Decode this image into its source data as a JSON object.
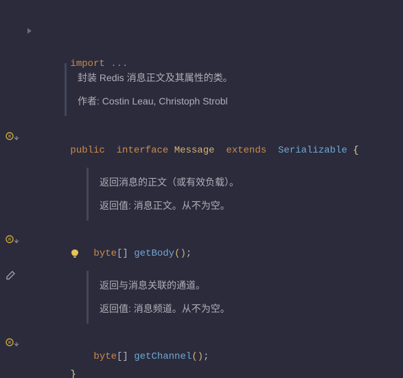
{
  "fold": {
    "import_kw": "import",
    "ellipsis": " ..."
  },
  "doc_class": {
    "summary": "封装 Redis 消息正文及其属性的类。",
    "author_label": "作者: ",
    "authors": "Costin Leau, Christoph Strobl"
  },
  "decl": {
    "kw_public": "public",
    "kw_interface": "interface",
    "name": "Message",
    "kw_extends": "extends",
    "super": "Serializable",
    "open": " {"
  },
  "method1": {
    "doc_summary": "返回消息的正文（或有效负载）。",
    "doc_return_label": "返回值: ",
    "doc_return": "消息正文。从不为空。",
    "ret_type": "byte",
    "brackets": "[]",
    "name": "getBody",
    "parens": "()",
    "semi": ";"
  },
  "method2": {
    "doc_summary": "返回与消息关联的通道。",
    "doc_return_label": "返回值: ",
    "doc_return": "消息频道。从不为空。",
    "ret_type": "byte",
    "brackets": "[]",
    "name": "getChannel",
    "parens": "()",
    "semi": ";"
  },
  "close_brace": "}"
}
